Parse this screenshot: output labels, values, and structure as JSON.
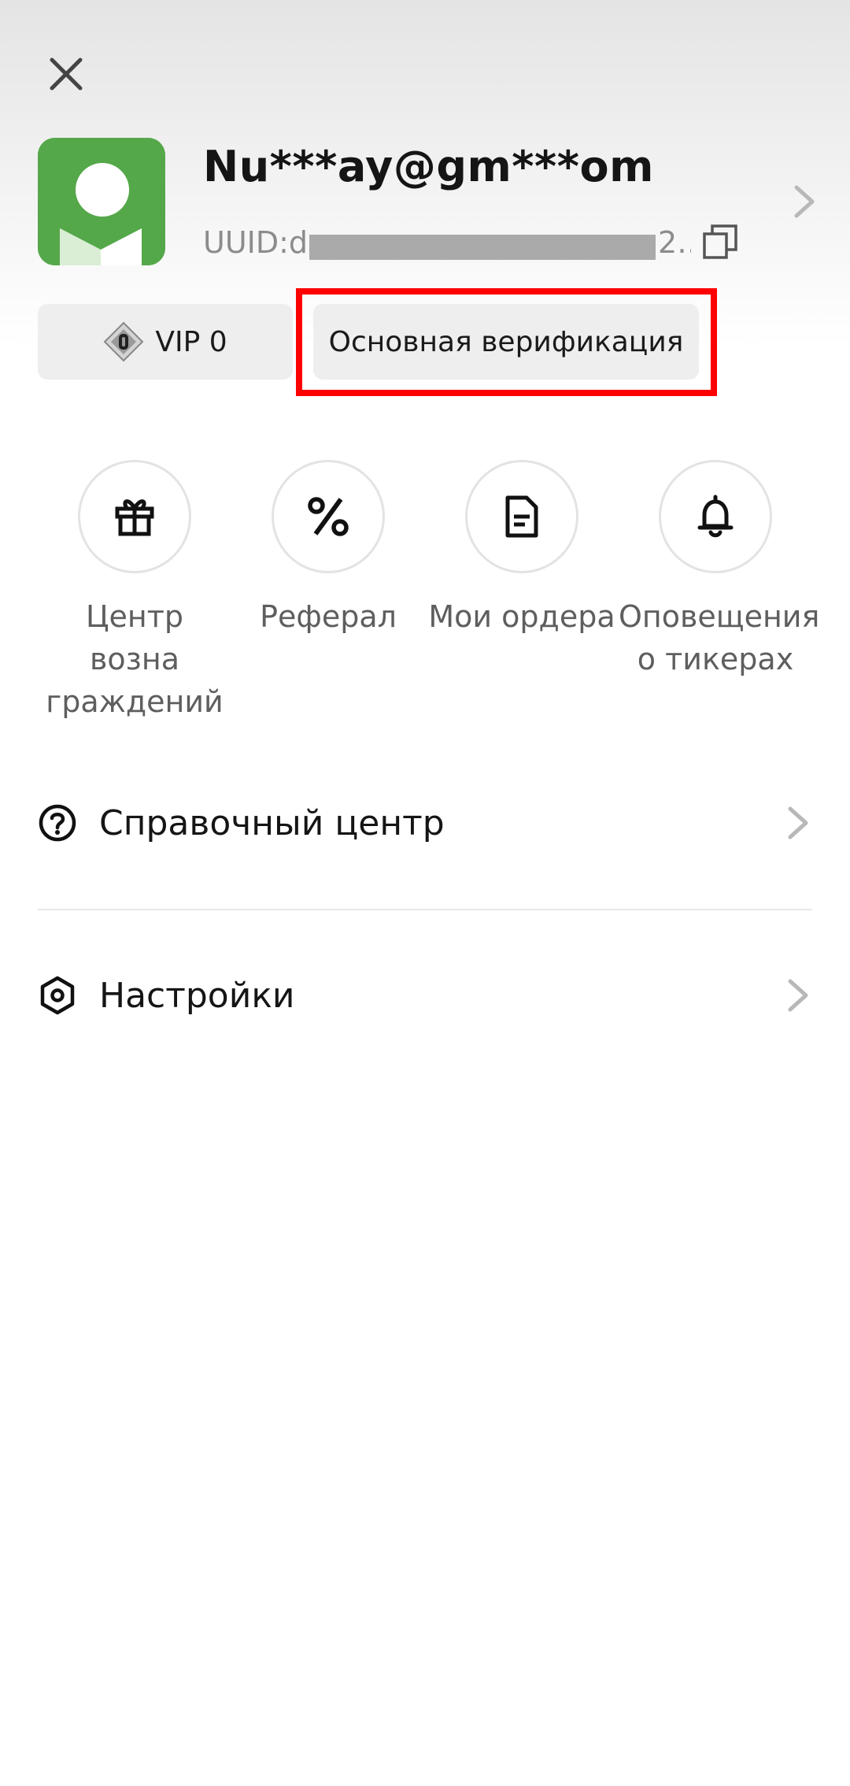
{
  "profile": {
    "username": "Nu***ay@gm***om",
    "uuid": "UUID:dc",
    "uuid_tail": "2…"
  },
  "badges": {
    "vip_label": "VIP 0",
    "verification_label": "Основная верификация"
  },
  "quick_actions": [
    {
      "label": "Центр возна граждений",
      "icon": "gift-icon"
    },
    {
      "label": "Реферал",
      "icon": "percent-icon"
    },
    {
      "label": "Мои ордера",
      "icon": "document-icon"
    },
    {
      "label": "Оповещения о тикерах",
      "icon": "bell-icon"
    }
  ],
  "menu": [
    {
      "label": "Справочный центр",
      "icon": "help-circle-icon"
    },
    {
      "label": "Настройки",
      "icon": "hexagon-settings-icon"
    }
  ],
  "colors": {
    "avatar_bg": "#55a84a",
    "highlight_frame": "#ff0000",
    "pill_bg": "#eeeeee"
  }
}
